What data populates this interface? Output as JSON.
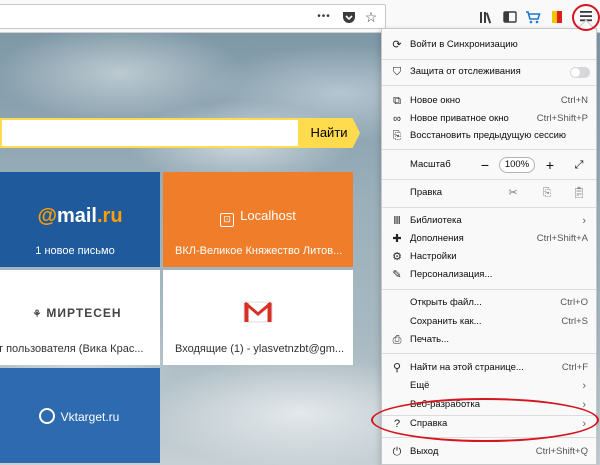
{
  "toolbar": {
    "dots": "•••",
    "pocket_icon": "pocket-icon",
    "star_icon": "star-icon",
    "library_icon": "library-icon",
    "sidebar_icon": "sidebar-icon",
    "cart_icon": "cart-icon",
    "bookmark_icon": "bookmark-icon",
    "menu_icon": "hamburger-menu-icon"
  },
  "search": {
    "button_label": "Найти",
    "value": ""
  },
  "tiles": [
    {
      "name": "mailru",
      "logo_at": "@",
      "logo_text": "mail",
      "logo_tld": ".ru",
      "subtitle": "1 новое письмо"
    },
    {
      "name": "localhost",
      "title": "Localhost",
      "subtitle": "ВКЛ-Великое Княжество Литов..."
    },
    {
      "name": "mirtesen",
      "title": "МИРТЕСЕН",
      "subtitle": "т пользователя (Вика Крас..."
    },
    {
      "name": "gmail",
      "title": "M",
      "subtitle": "Входящие (1) - ylasvetnzbt@gm..."
    },
    {
      "name": "vktarget",
      "title": "Vktarget.ru",
      "subtitle": ""
    }
  ],
  "menu": {
    "sync": "Войти в Синхронизацию",
    "tracking": "Защита от отслеживания",
    "new_window": {
      "label": "Новое окно",
      "shortcut": "Ctrl+N"
    },
    "private_window": {
      "label": "Новое приватное окно",
      "shortcut": "Ctrl+Shift+P"
    },
    "restore_session": "Восстановить предыдущую сессию",
    "zoom": {
      "label": "Масштаб",
      "minus": "−",
      "value": "100%",
      "plus": "+"
    },
    "edit": "Правка",
    "library": "Библиотека",
    "addons": {
      "label": "Дополнения",
      "shortcut": "Ctrl+Shift+A"
    },
    "settings": "Настройки",
    "customize": "Персонализация...",
    "open_file": {
      "label": "Открыть файл...",
      "shortcut": "Ctrl+O"
    },
    "save_as": {
      "label": "Сохранить как...",
      "shortcut": "Ctrl+S"
    },
    "print": "Печать...",
    "find": {
      "label": "Найти на этой странице...",
      "shortcut": "Ctrl+F"
    },
    "more": "Ещё",
    "web_dev": "Веб-разработка",
    "help": "Справка",
    "exit": {
      "label": "Выход",
      "shortcut": "Ctrl+Shift+Q"
    },
    "chevron": "›"
  },
  "colors": {
    "annotation": "#d4161d",
    "search_accent": "#ffdb4d",
    "mail_tile": "#1e5a9c",
    "localhost_tile": "#f07d2a"
  }
}
